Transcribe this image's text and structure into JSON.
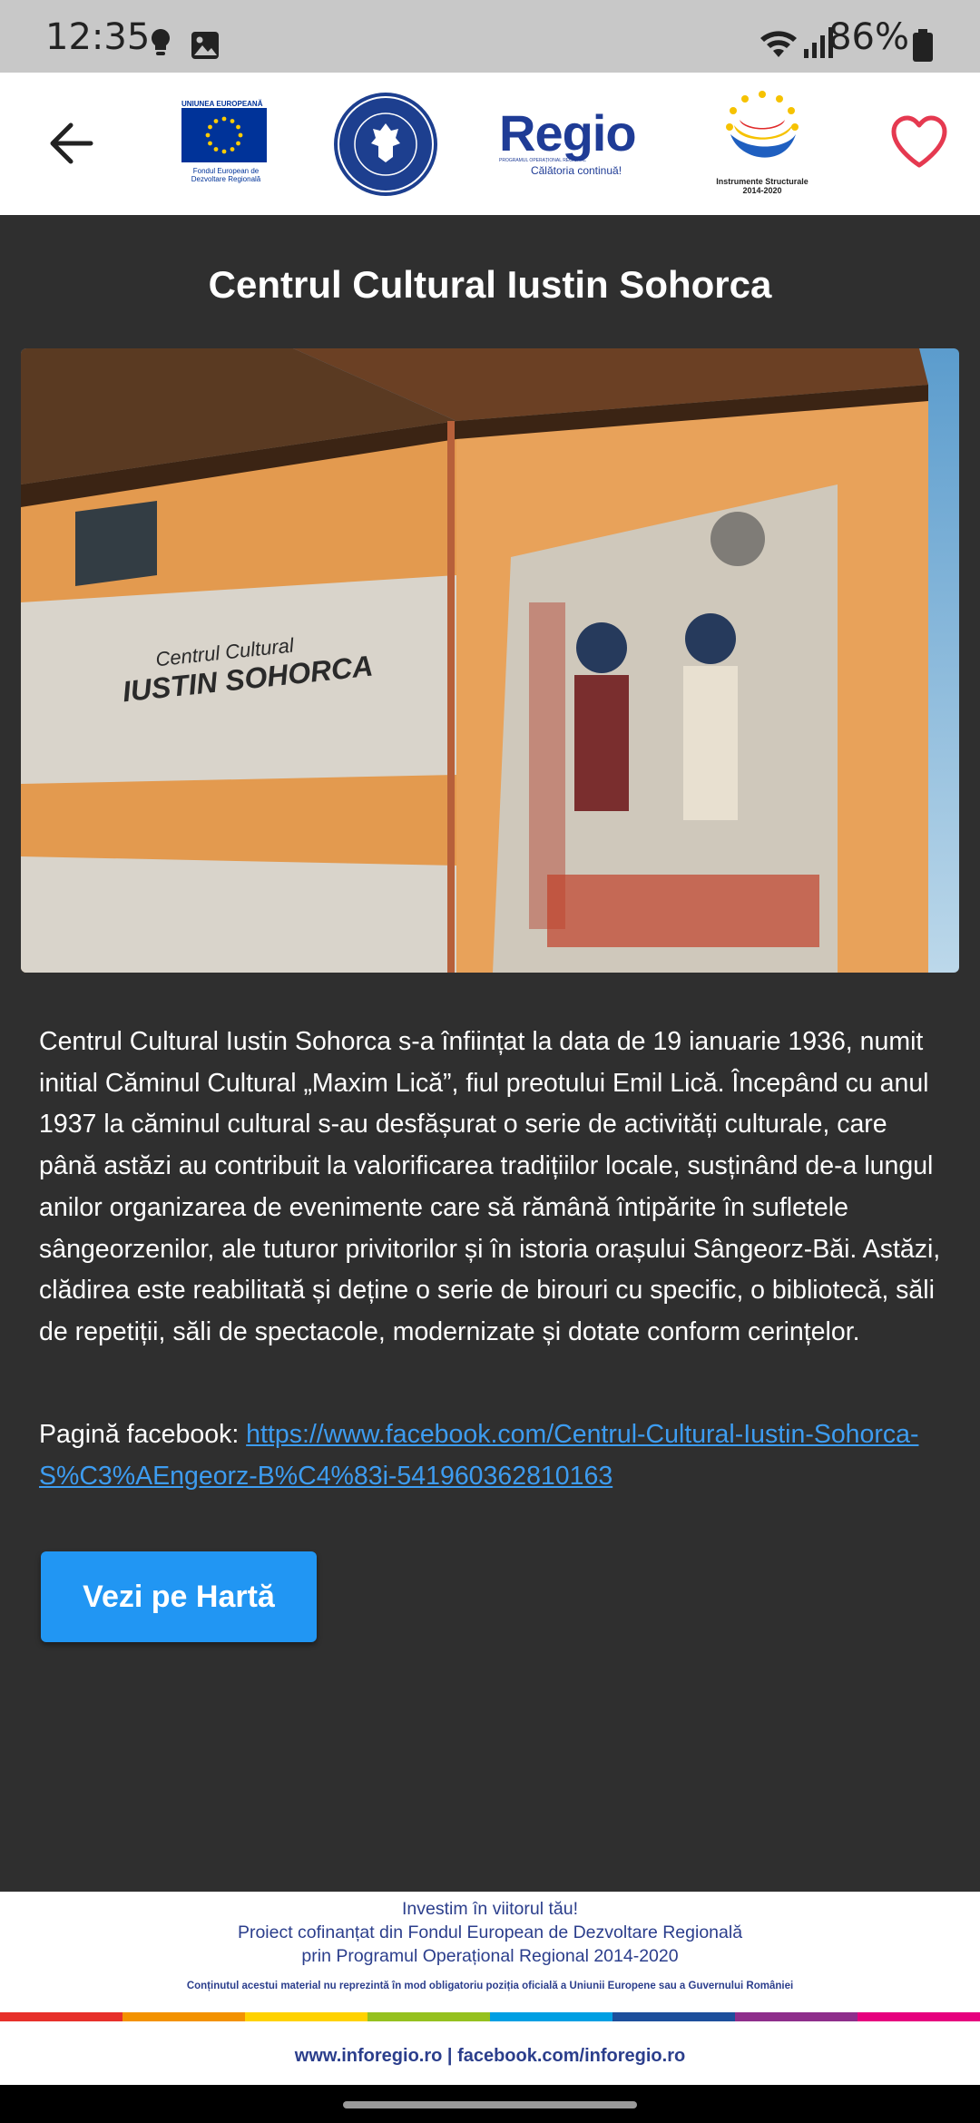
{
  "status_bar": {
    "time": "12:35",
    "battery": "86%"
  },
  "header": {
    "eu_logo": {
      "top": "UNIUNEA EUROPEANĂ",
      "bottom1": "Fondul European de",
      "bottom2": "Dezvoltare Regională"
    },
    "gov_logo": {
      "text": "GUVERNUL ROMÂNIEI"
    },
    "regio_logo": {
      "word": "Regio",
      "small": "PROGRAMUL OPERAȚIONAL REGIONAL",
      "tagline": "Călătoria continuă!"
    },
    "is_logo": {
      "line1": "Instrumente Structurale",
      "line2": "2014-2020"
    }
  },
  "page": {
    "title": "Centrul Cultural Iustin Sohorca",
    "photo_sign_line1": "Centrul Cultural",
    "photo_sign_line2": "IUSTIN SOHORCA",
    "description": "Centrul Cultural Iustin Sohorca s-a înființat la data de 19 ianuarie 1936, numit initial Căminul Cultural „Maxim Lică”, fiul preotului Emil Lică. Începând cu anul 1937 la căminul cultural s-au desfășurat o serie de activități culturale, care până astăzi au contribuit la valorificarea tradițiilor locale, susținând de-a lungul anilor organizarea de evenimente care să rămână întipărite în sufletele sângeorzenilor, ale tuturor privitorilor și în istoria orașului Sângeorz-Băi. Astăzi, clădirea este reabilitată și deține o serie de birouri cu specific, o bibliotecă, săli de repetiții, săli de spectacole, modernizate și dotate conform cerințelor.",
    "facebook_label": "Pagină facebook: ",
    "facebook_url": "https://www.facebook.com/Centrul-Cultural-Iustin-Sohorca-S%C3%AEngeorz-B%C4%83i-541960362810163",
    "map_button": "Vezi pe Hartă"
  },
  "footer": {
    "line1": "Investim în viitorul tău!",
    "line2": "Proiect cofinanțat din Fondul European de Dezvoltare Regională",
    "line3": "prin Programul Operațional Regional 2014-2020",
    "disclaimer": "Conținutul acestui material nu reprezintă în mod obligatoriu poziția oficială a Uniunii Europene sau a Guvernului României",
    "links": "www.inforegio.ro   |   facebook.com/inforegio.ro"
  },
  "colors": {
    "accent": "#2196f3",
    "heart": "#e53950",
    "link": "#3d9cf0",
    "background": "#2f2f2f"
  }
}
